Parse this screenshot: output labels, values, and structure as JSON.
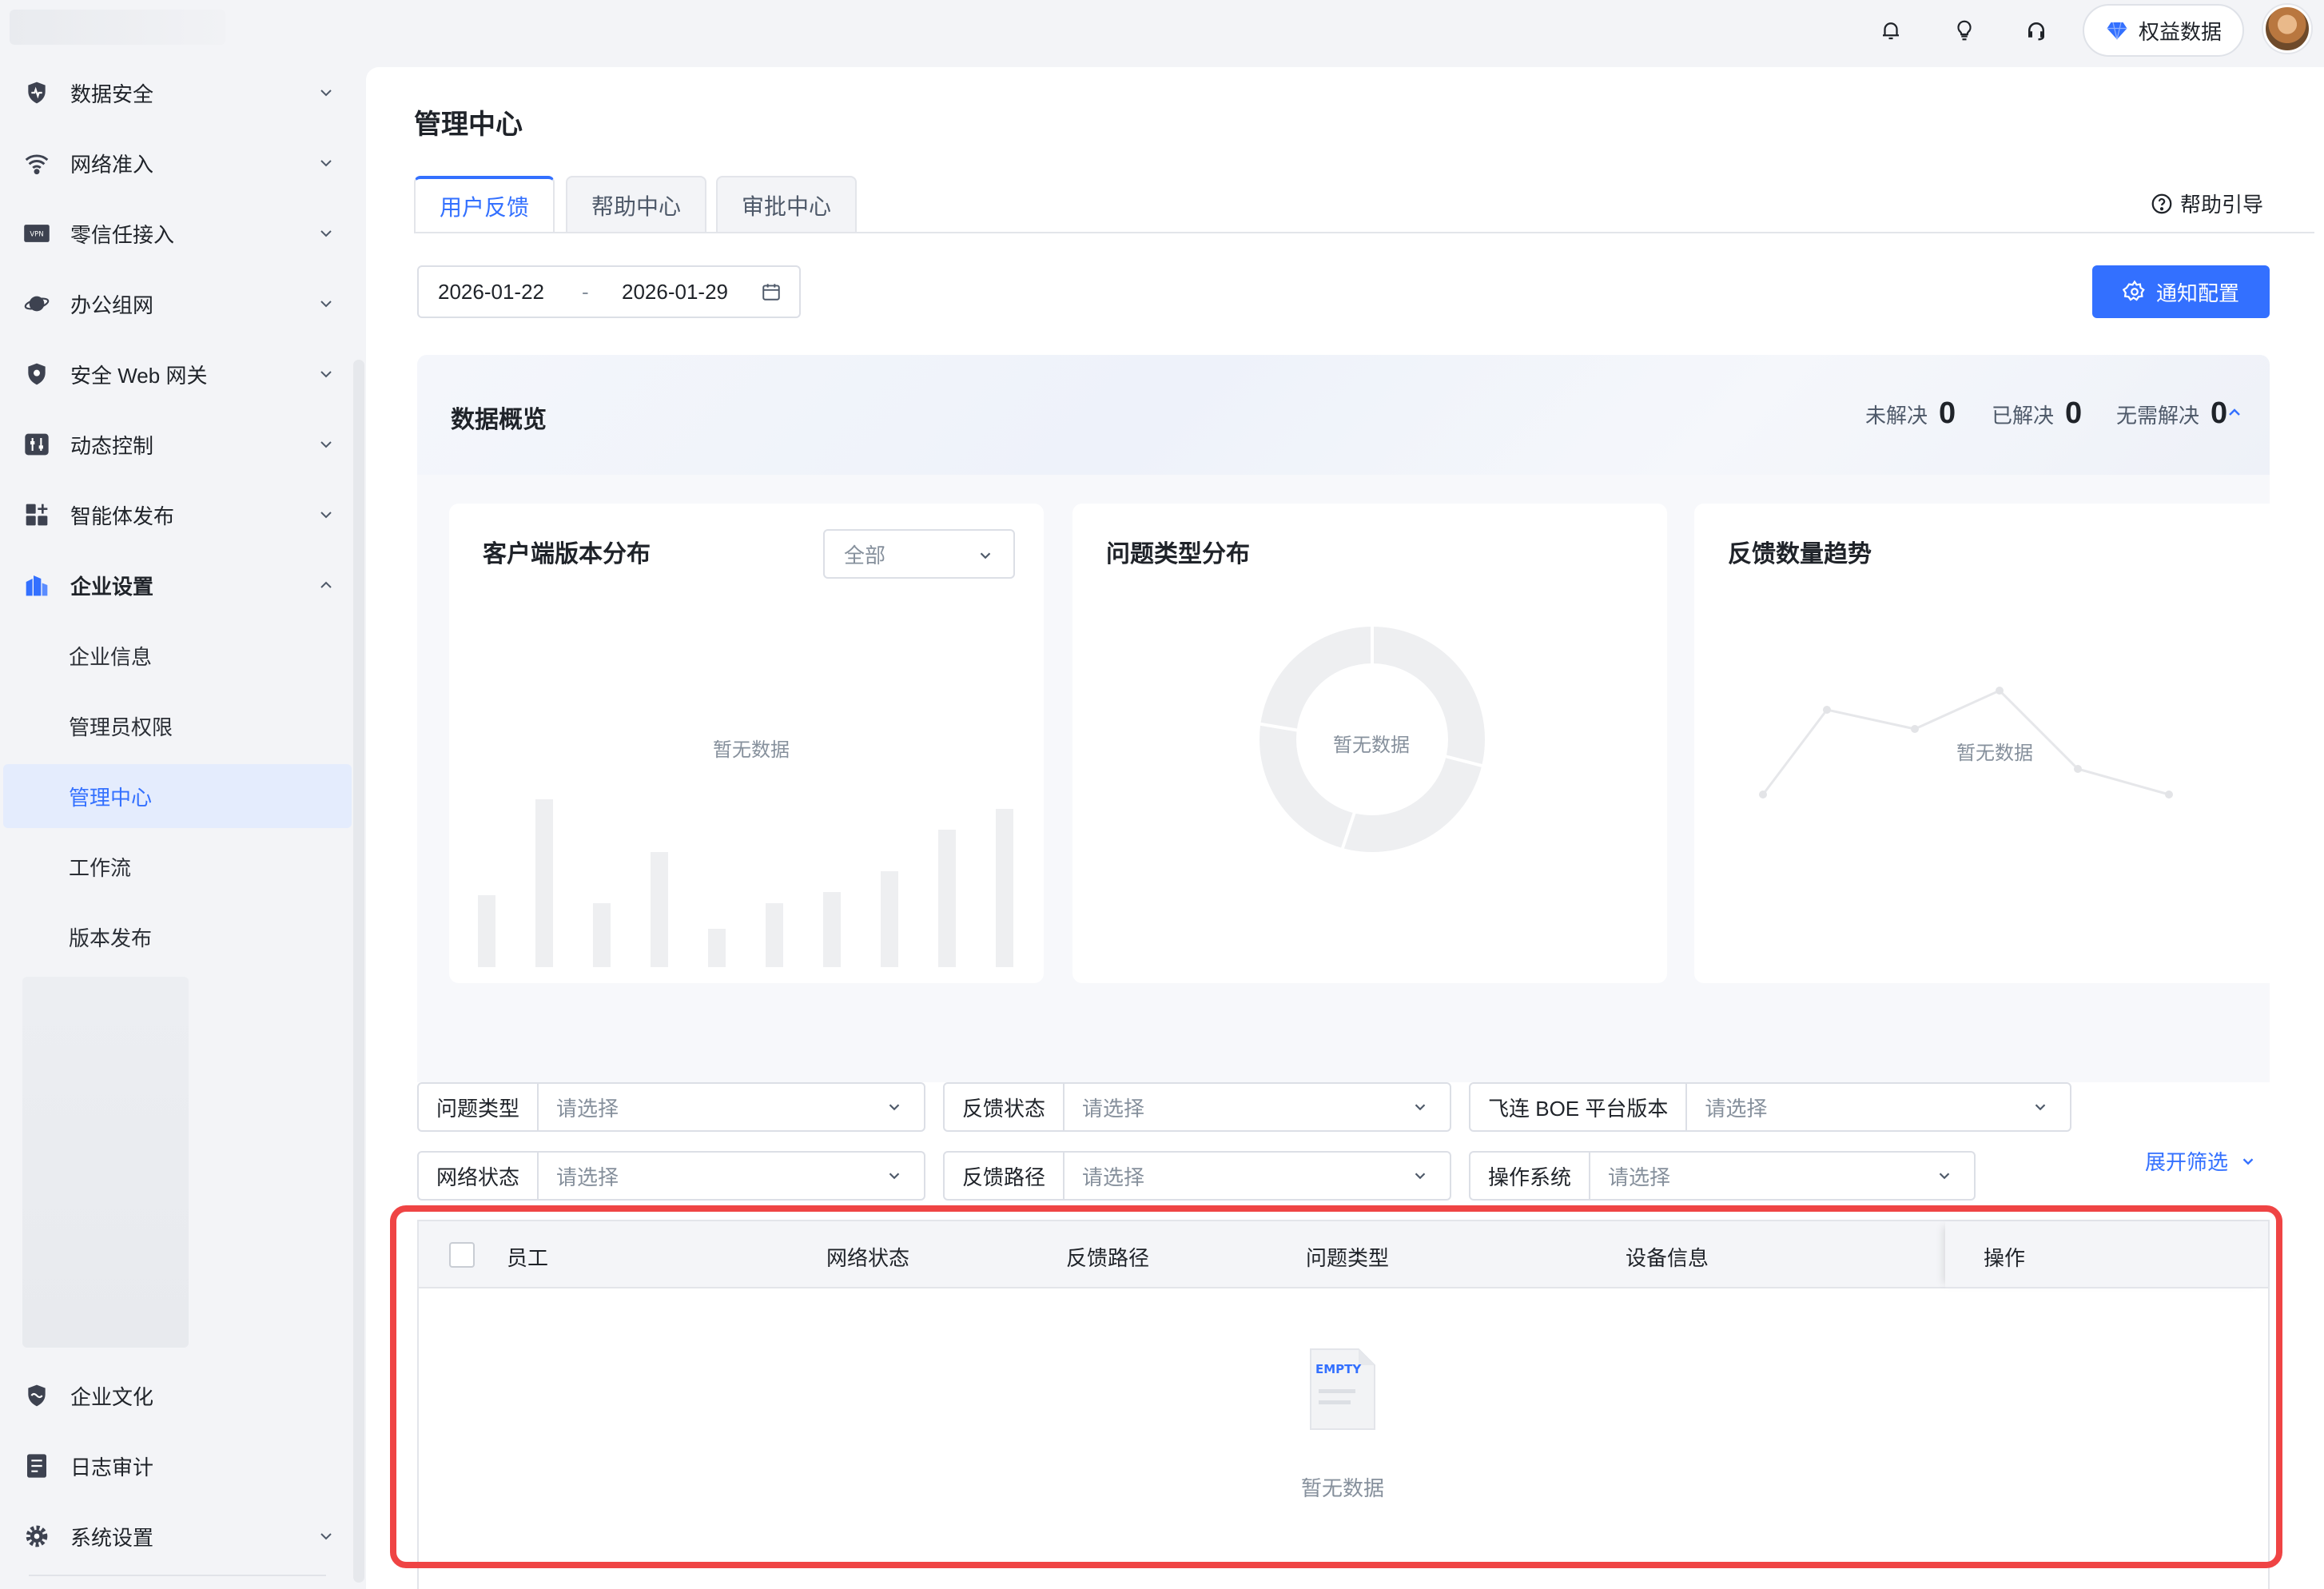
{
  "header": {
    "icons": [
      "bell-icon",
      "lightbulb-icon",
      "headset-icon"
    ],
    "perk_label": "权益数据",
    "accent": "#3370ff"
  },
  "sidebar": {
    "items": [
      {
        "label": "数据安全",
        "icon": "shield-pulse-icon"
      },
      {
        "label": "网络准入",
        "icon": "wifi-icon"
      },
      {
        "label": "零信任接入",
        "icon": "vpn-icon"
      },
      {
        "label": "办公组网",
        "icon": "planet-icon"
      },
      {
        "label": "安全 Web 网关",
        "icon": "shield-icon"
      },
      {
        "label": "动态控制",
        "icon": "sliders-icon"
      },
      {
        "label": "智能体发布",
        "icon": "grid-plus-icon"
      },
      {
        "label": "企业设置",
        "icon": "buildings-icon"
      }
    ],
    "sub_items": [
      "企业信息",
      "管理员权限",
      "管理中心",
      "工作流",
      "版本发布"
    ],
    "active_sub": "管理中心",
    "bottom_items": [
      {
        "label": "企业文化",
        "icon": "culture-icon"
      },
      {
        "label": "日志审计",
        "icon": "log-icon"
      },
      {
        "label": "系统设置",
        "icon": "gear-icon"
      }
    ]
  },
  "main": {
    "title": "管理中心",
    "tabs": [
      {
        "label": "用户反馈",
        "active": true
      },
      {
        "label": "帮助中心",
        "active": false
      },
      {
        "label": "审批中心",
        "active": false
      }
    ],
    "help_guide": "帮助引导",
    "date_start": "2026-01-22",
    "date_sep": "-",
    "date_end": "2026-01-29",
    "notify_button": "通知配置"
  },
  "overview": {
    "title": "数据概览",
    "stats": [
      {
        "label": "未解决",
        "value": "0"
      },
      {
        "label": "已解决",
        "value": "0"
      },
      {
        "label": "无需解决",
        "value": "0"
      }
    ],
    "cards": [
      {
        "title": "客户端版本分布",
        "select_value": "全部",
        "empty": "暂无数据"
      },
      {
        "title": "问题类型分布",
        "empty": "暂无数据"
      },
      {
        "title": "反馈数量趋势",
        "empty": "暂无数据"
      }
    ]
  },
  "filters": [
    {
      "label": "问题类型",
      "placeholder": "请选择"
    },
    {
      "label": "反馈状态",
      "placeholder": "请选择"
    },
    {
      "label": "飞连 BOE 平台版本",
      "placeholder": "请选择"
    },
    {
      "label": "网络状态",
      "placeholder": "请选择"
    },
    {
      "label": "反馈路径",
      "placeholder": "请选择"
    },
    {
      "label": "操作系统",
      "placeholder": "请选择"
    }
  ],
  "expand_filter": "展开筛选",
  "table": {
    "columns": [
      "员工",
      "网络状态",
      "反馈路径",
      "问题类型",
      "设备信息",
      "操作"
    ],
    "empty_icon_text": "EMPTY",
    "empty_text": "暂无数据"
  }
}
